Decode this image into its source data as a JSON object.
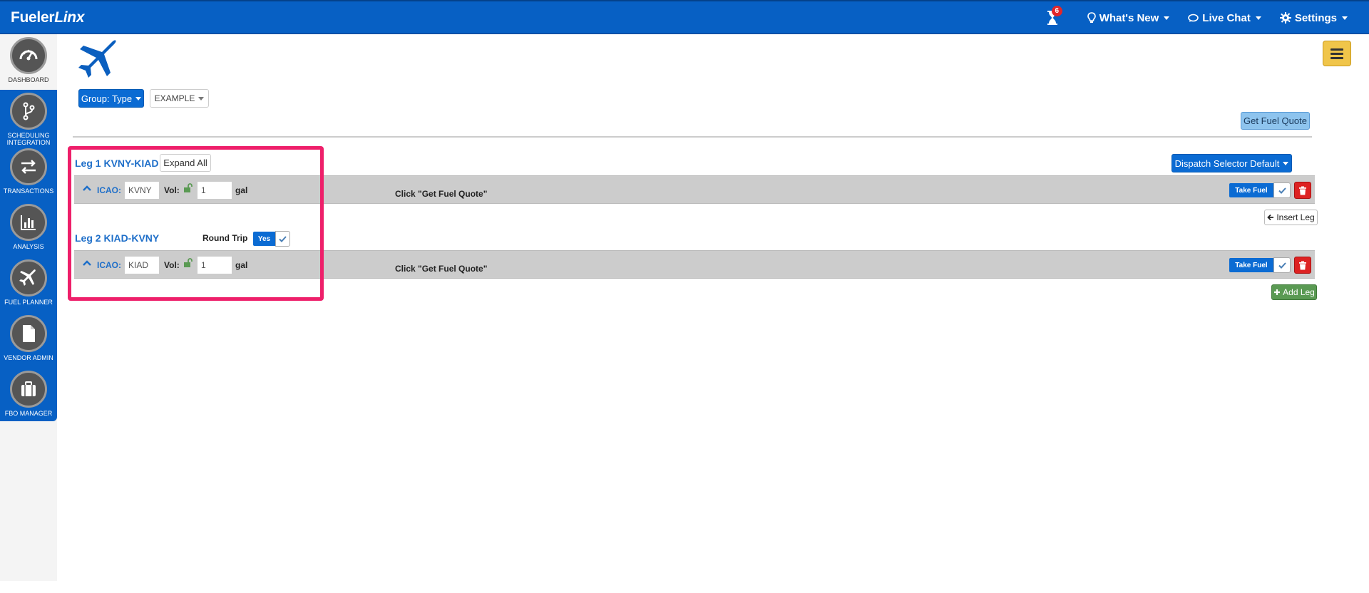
{
  "app": {
    "brand_prefix": "Fueler",
    "brand_suffix": "Linx"
  },
  "topnav": {
    "notification_count": "6",
    "whats_new": "What's New",
    "live_chat": "Live Chat",
    "settings": "Settings"
  },
  "sidebar": {
    "items": [
      {
        "label": "DASHBOARD",
        "icon": "dashboard-gauge-icon"
      },
      {
        "label": "SCHEDULING INTEGRATION",
        "icon": "branch-icon"
      },
      {
        "label": "TRANSACTIONS",
        "icon": "swap-arrows-icon"
      },
      {
        "label": "ANALYSIS",
        "icon": "bar-chart-icon"
      },
      {
        "label": "FUEL PLANNER",
        "icon": "plane-icon"
      },
      {
        "label": "VENDOR ADMIN",
        "icon": "document-icon"
      },
      {
        "label": "FBO MANAGER",
        "icon": "briefcase-icon"
      }
    ]
  },
  "toolbar": {
    "group_button": "Group: Type",
    "example_select": "EXAMPLE",
    "get_fuel_quote": "Get Fuel Quote",
    "dispatch_selector": "Dispatch Selector Default"
  },
  "legs": [
    {
      "title": "Leg 1 KVNY-KIAD",
      "icao_label": "ICAO:",
      "icao_value": "KVNY",
      "vol_label": "Vol:",
      "vol_value": "1",
      "unit": "gal",
      "hint": "Click \"Get Fuel Quote\"",
      "take_fuel": "Take Fuel"
    },
    {
      "title": "Leg 2 KIAD-KVNY",
      "icao_label": "ICAO:",
      "icao_value": "KIAD",
      "vol_label": "Vol:",
      "vol_value": "1",
      "unit": "gal",
      "hint": "Click \"Get Fuel Quote\"",
      "take_fuel": "Take Fuel"
    }
  ],
  "expand_all": "Expand All",
  "round_trip": {
    "label": "Round Trip",
    "value": "Yes"
  },
  "insert_leg": "Insert Leg",
  "add_leg": "Add Leg",
  "colors": {
    "primary": "#0760c4",
    "highlight": "#ee1f6a",
    "danger": "#dd2222",
    "success": "#5a9a53"
  }
}
